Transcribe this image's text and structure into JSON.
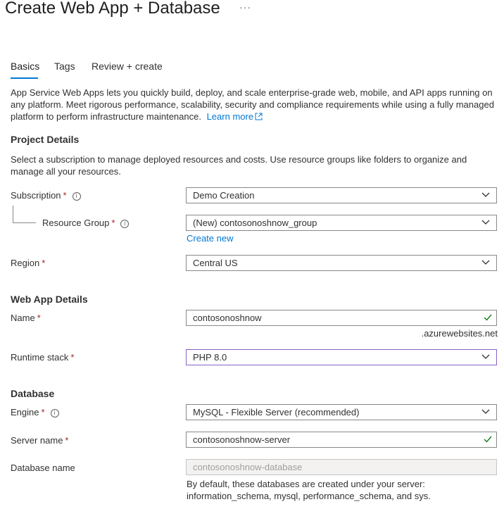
{
  "header": {
    "title": "Create Web App + Database",
    "more_label": "···"
  },
  "tabs": [
    {
      "label": "Basics",
      "active": true
    },
    {
      "label": "Tags",
      "active": false
    },
    {
      "label": "Review + create",
      "active": false
    }
  ],
  "intro": {
    "text": "App Service Web Apps lets you quickly build, deploy, and scale enterprise-grade web, mobile, and API apps running on any platform. Meet rigorous performance, scalability, security and compliance requirements while using a fully managed platform to perform infrastructure maintenance.",
    "learn_more": "Learn more"
  },
  "project_details": {
    "heading": "Project Details",
    "description": "Select a subscription to manage deployed resources and costs. Use resource groups like folders to organize and manage all your resources.",
    "subscription": {
      "label": "Subscription",
      "required": "*",
      "value": "Demo Creation"
    },
    "resource_group": {
      "label": "Resource Group",
      "required": "*",
      "value": "(New) contosonoshnow_group",
      "create_new": "Create new"
    },
    "region": {
      "label": "Region",
      "required": "*",
      "value": "Central US"
    }
  },
  "web_app_details": {
    "heading": "Web App Details",
    "name": {
      "label": "Name",
      "required": "*",
      "value": "contosonoshnow",
      "suffix": ".azurewebsites.net"
    },
    "runtime_stack": {
      "label": "Runtime stack",
      "required": "*",
      "value": "PHP 8.0"
    }
  },
  "database": {
    "heading": "Database",
    "engine": {
      "label": "Engine",
      "required": "*",
      "value": "MySQL - Flexible Server (recommended)"
    },
    "server_name": {
      "label": "Server name",
      "required": "*",
      "value": "contosonoshnow-server"
    },
    "database_name": {
      "label": "Database name",
      "value": "contosonoshnow-database",
      "note": "By default, these databases are created under your server: information_schema, mysql, performance_schema, and sys."
    }
  },
  "colors": {
    "accent": "#0078d4",
    "required": "#a4262c",
    "focus_border": "#8661c5",
    "valid_check": "#107c10"
  }
}
